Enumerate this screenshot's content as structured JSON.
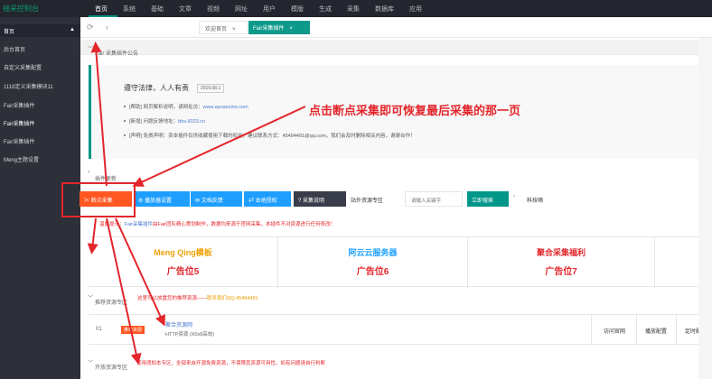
{
  "header": {
    "logo": "接采控制台",
    "nav": [
      "首页",
      "系统",
      "基础",
      "文章",
      "视频",
      "网址",
      "用户",
      "模版",
      "生成",
      "采集",
      "数据库",
      "应用"
    ]
  },
  "sidebar": {
    "section": "首页",
    "items": [
      "后台首页",
      "自定义采集配置",
      "1118定义采集模块11",
      "Fair采集插件",
      "Fair采集插件",
      "Fair采集插件",
      "Meng主题设置"
    ]
  },
  "tabs": {
    "welcome": "欢迎首页",
    "plugin": "Fair采集插件"
  },
  "notice": {
    "header": "Fair 采集插件公告",
    "title": "遵守法律，人人有责",
    "date": "2019.08.1",
    "lines": [
      {
        "pre": "[帮助] 网页解析说明，请网址访：",
        "link": "www.ayuaocms.com"
      },
      {
        "pre": "[新增] 问题反馈地址：",
        "link": "bbs.6023.cn"
      },
      {
        "pre": "[声明] 免责声明：资本插件仅供收藏使用下载的权益，建议联系方式：45494491@qq.com，我们会及时删除相关内容，谢谢合作！",
        "link": ""
      }
    ]
  },
  "annotation": "点击断点采集即可恢复最后采集的那一页",
  "update_header": "插件更新",
  "buttons": {
    "b1": "✂ 断点采集",
    "b2": "⚙ 播放器设置",
    "b3": "✉ 文档反馈",
    "b4": "⇄ 本地授权",
    "b5": "? 采集说明",
    "zone": "站外资源专区",
    "search_placeholder": "请输入关键字",
    "search": "立即搜索",
    "tech": "科技嘀"
  },
  "warning": {
    "pre": "温馨提示：",
    "plugin": "Fair采集插件",
    "text": "由Fair团队精心策划制作，数据均来源于官网采集，本插件不对资源进行任何修改！"
  },
  "ads": [
    {
      "title": "Meng Qing模板",
      "slot": "广告位5",
      "color": "#f0a30a"
    },
    {
      "title": "阿云云服务器",
      "slot": "广告位6",
      "color": "#1e9fff"
    },
    {
      "title": "聚合采集福利",
      "slot": "广告位7",
      "color": "#e3262c"
    },
    {
      "title": "",
      "slot": "",
      "color": "#333333"
    }
  ],
  "recommend": {
    "header": "推荐资源专区",
    "note_pre": "这里可以放置您的推荐资源——",
    "note_link": "联系我们QQ:45494491"
  },
  "row": {
    "num": "01",
    "badge": "推荐资源",
    "name": "聚合资源网",
    "desc": "HTTP资源 (X0x8高效)",
    "actions": [
      "访问官网",
      "播放配置",
      "定时配置"
    ]
  },
  "open_header": "开放资源专区",
  "open_note": "使用须知本专区，全部来自开源免费资源，不保障其资源可用性，如有问题请自行判断"
}
